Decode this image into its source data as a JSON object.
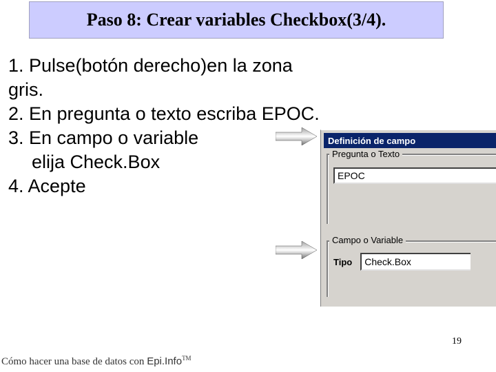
{
  "title": "Paso 8: Crear variables Checkbox(3/4).",
  "steps": {
    "s1": "1. Pulse(botón derecho)en la zona gris.",
    "s2": "2. En pregunta o texto escriba EPOC.",
    "s3a": "3. En campo o variable",
    "s3b": "elija Check.Box",
    "s4": "4. Acepte"
  },
  "dialog": {
    "title": "Definición de campo",
    "group1_label": "Pregunta o Texto",
    "input_value": "EPOC",
    "group2_label": "Campo o Variable",
    "tipo_label": "Tipo",
    "combo_value": "Check.Box"
  },
  "page_number": "19",
  "footer": {
    "prefix": "Cómo hacer una base de datos con ",
    "brand": "Epi.Info",
    "tm": "TM"
  }
}
